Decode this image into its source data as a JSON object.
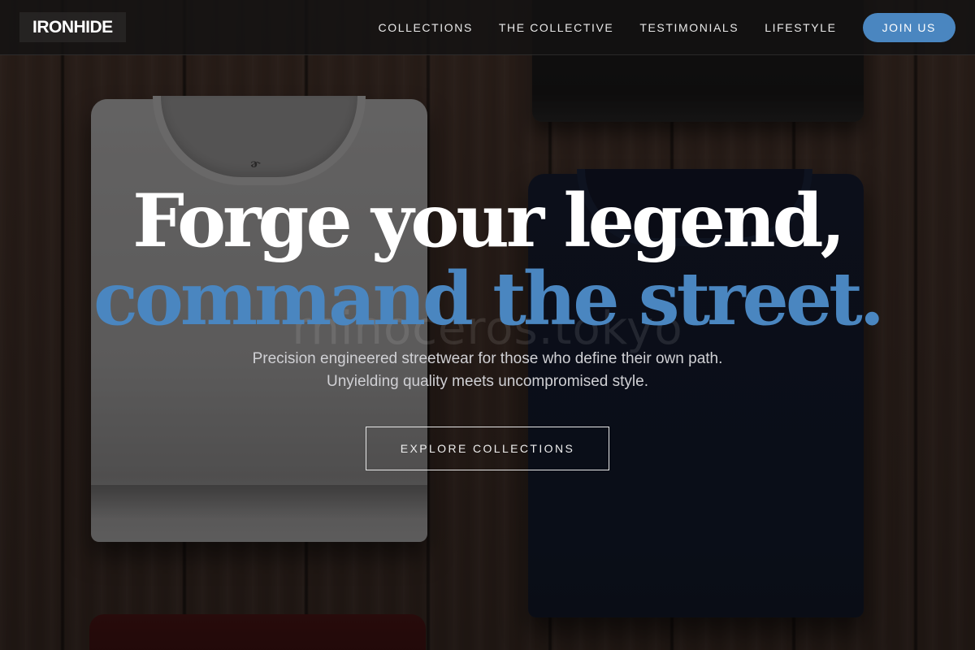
{
  "header": {
    "logo": "IRONHIDE",
    "nav": [
      {
        "label": "COLLECTIONS"
      },
      {
        "label": "THE COLLECTIVE"
      },
      {
        "label": "TESTIMONIALS"
      },
      {
        "label": "LIFESTYLE"
      }
    ],
    "join_label": "JOIN US"
  },
  "hero": {
    "headline_line1": "Forge your legend,",
    "headline_line2": "command the street.",
    "subtitle_line1": "Precision engineered streetwear for those who define their own path.",
    "subtitle_line2": "Unyielding quality meets uncompromised style.",
    "cta_label": "EXPLORE COLLECTIONS",
    "watermark": "rhinoceros.tokyo"
  },
  "colors": {
    "accent": "#4a86c0",
    "header_bg": "#141212",
    "text_primary": "#ffffff",
    "text_secondary": "#d0d0d4"
  },
  "icons": {
    "background": "wood-plank-texture",
    "products": [
      "grey-tshirt",
      "black-tshirt",
      "navy-tshirt",
      "red-tshirt"
    ]
  }
}
